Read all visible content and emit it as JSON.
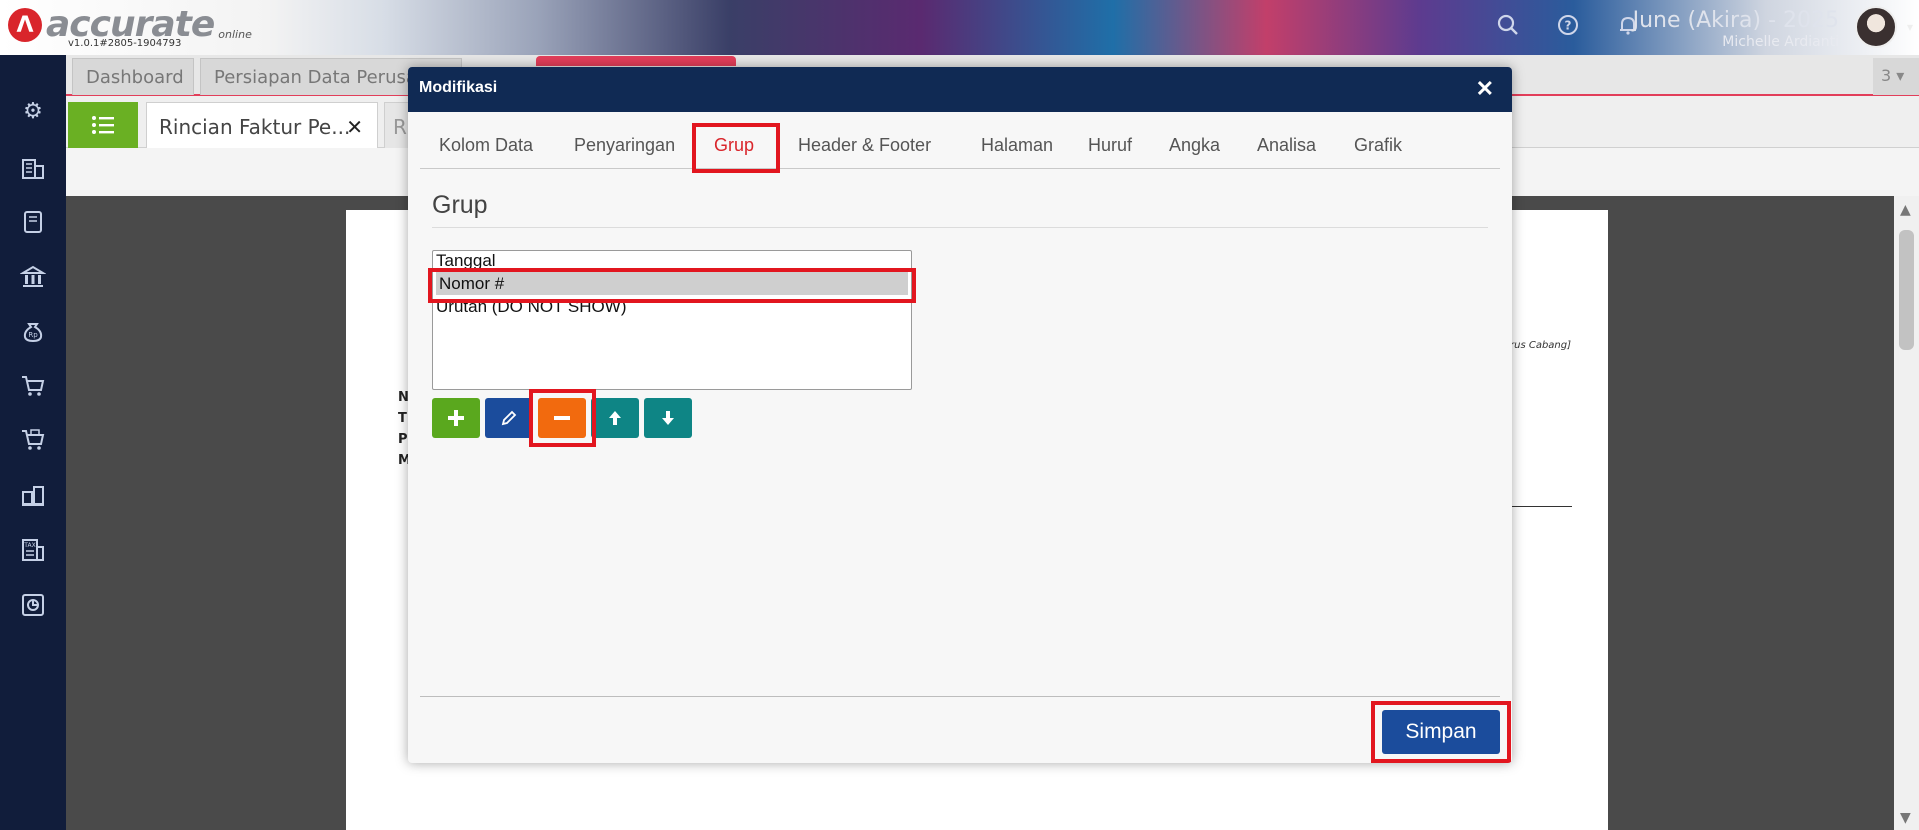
{
  "app": {
    "version": "v1.0.1#2805-1904793",
    "logo_text": "accurate",
    "logo_sub": "online"
  },
  "header": {
    "period": "June (Akira) - 2025",
    "user": "Michelle Ardianti",
    "icons": [
      "search-icon",
      "help-icon",
      "bell-icon"
    ]
  },
  "tabs_top": [
    {
      "label": "Dashboard"
    },
    {
      "label": "Persiapan Data Perusa"
    }
  ],
  "tabs_top_count": "3",
  "tabs_doc": {
    "active_label": "Rincian Faktur Pe...",
    "next_label": "R"
  },
  "document": {
    "left_letters": [
      "N",
      "T",
      "P",
      "M"
    ],
    "right_italic": "rus Cabang]"
  },
  "modal": {
    "title": "Modifikasi",
    "tabs": [
      {
        "label": "Kolom Data"
      },
      {
        "label": "Penyaringan"
      },
      {
        "label": "Grup",
        "active": true
      },
      {
        "label": "Header & Footer"
      },
      {
        "label": "Halaman"
      },
      {
        "label": "Huruf"
      },
      {
        "label": "Angka"
      },
      {
        "label": "Analisa"
      },
      {
        "label": "Grafik"
      }
    ],
    "section_title": "Grup",
    "list_items": [
      "Tanggal",
      "Nomor #",
      "Urutan (DO NOT SHOW)"
    ],
    "selected_item": "Nomor #",
    "buttons": [
      {
        "name": "add",
        "icon": "plus-icon",
        "color": "#5aa81e"
      },
      {
        "name": "edit",
        "icon": "pencil-icon",
        "color": "#1b4c9c"
      },
      {
        "name": "remove",
        "icon": "minus-icon",
        "color": "#f26a0e"
      },
      {
        "name": "move-up",
        "icon": "arrow-up-icon",
        "color": "#0e8585"
      },
      {
        "name": "move-down",
        "icon": "arrow-down-icon",
        "color": "#0e8585"
      }
    ],
    "save_label": "Simpan"
  },
  "colors": {
    "highlight": "#e2161f",
    "modal_header": "#102a54",
    "sidebar": "#111d3b",
    "accent_red": "#d9252b"
  }
}
